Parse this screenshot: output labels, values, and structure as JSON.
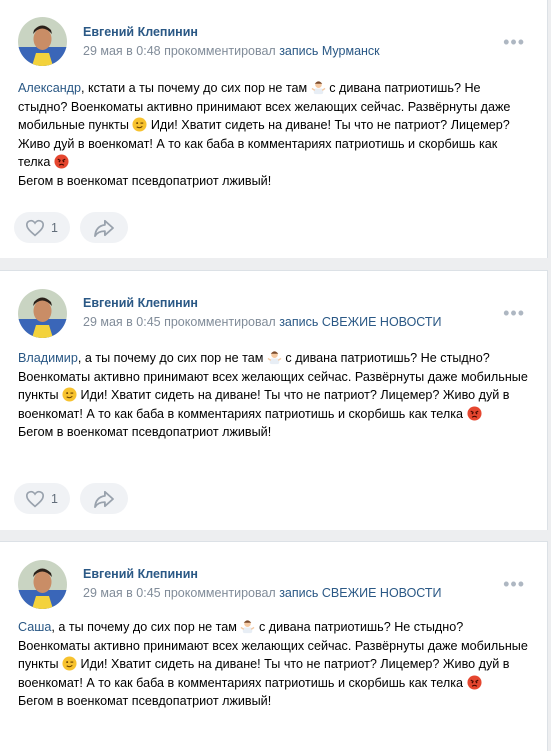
{
  "colors": {
    "link": "#2a5885",
    "meta": "#818c99",
    "bg": "#edeef0",
    "button_bg": "#f0f2f5"
  },
  "posts": [
    {
      "author": "Евгений Клепинин",
      "time": "29 мая в 0:48",
      "action": " прокомментировал ",
      "target": "запись Мурманск",
      "reply_to": "Александр",
      "lines": [
        ", кстати а ты почему до сих пор не там ",
        " с дивана патриотишь? Не стыдно? Военкоматы активно принимают всех желающих сейчас. Развёрнуты даже мобильные пункты ",
        " Иди! Хватит сидеть на диване! Ты что не патриот? Лицемер? Живо дуй в военкомат! А то как баба в комментариях патриотишь и скорбишь как телка ",
        "Бегом в военкомат псевдопатриот лживый!"
      ],
      "likes": "1",
      "more_icon": "ellipsis-icon"
    },
    {
      "author": "Евгений Клепинин",
      "time": "29 мая в 0:45",
      "action": " прокомментировал ",
      "target": "запись СВЕЖИЕ НОВОСТИ",
      "reply_to": "Владимир",
      "lines": [
        ", а ты почему до сих пор не там ",
        " с дивана патриотишь? Не стыдно? Военкоматы активно принимают всех желающих сейчас. Развёрнуты даже мобильные пункты ",
        " Иди! Хватит сидеть на диване! Ты что не патриот? Лицемер? Живо дуй в военкомат! А то как баба в комментариях патриотишь и скорбишь как телка ",
        "Бегом в военкомат псевдопатриот лживый!"
      ],
      "likes": "1",
      "more_icon": "ellipsis-icon"
    },
    {
      "author": "Евгений Клепинин",
      "time": "29 мая в 0:45",
      "action": " прокомментировал ",
      "target": "запись СВЕЖИЕ НОВОСТИ",
      "reply_to": "Саша",
      "lines": [
        ", а ты почему до сих пор не там ",
        " с дивана патриотишь? Не стыдно? Военкоматы активно принимают всех желающих сейчас. Развёрнуты даже мобильные пункты ",
        " Иди! Хватит сидеть на диване! Ты что не патриот? Лицемер? Живо дуй в военкомат! А то как баба в комментариях патриотишь и скорбишь как телка ",
        "Бегом в военкомат псевдопатриот лживый!"
      ],
      "likes": "",
      "more_icon": "ellipsis-icon"
    }
  ]
}
